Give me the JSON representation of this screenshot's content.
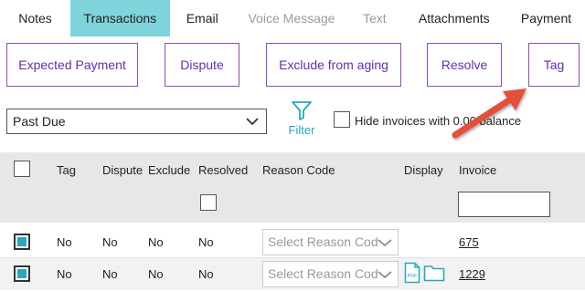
{
  "tabs": [
    {
      "label": "Notes",
      "state": "normal"
    },
    {
      "label": "Transactions",
      "state": "active"
    },
    {
      "label": "Email",
      "state": "normal"
    },
    {
      "label": "Voice Message",
      "state": "disabled"
    },
    {
      "label": "Text",
      "state": "disabled"
    },
    {
      "label": "Attachments",
      "state": "normal"
    },
    {
      "label": "Payment",
      "state": "normal"
    }
  ],
  "actions": {
    "expected_payment": "Expected Payment",
    "dispute": "Dispute",
    "exclude_from_aging": "Exclude from aging",
    "resolve": "Resolve",
    "tag": "Tag"
  },
  "filters": {
    "view_select_value": "Past Due",
    "filter_label": "Filter",
    "hide_zero_balance_label": "Hide invoices with 0.00 balance",
    "hide_zero_balance_checked": false
  },
  "grid": {
    "columns": {
      "tag": "Tag",
      "dispute": "Dispute",
      "exclude": "Exclude /",
      "resolved": "Resolved",
      "reason_code": "Reason Code",
      "display": "Display",
      "invoice": "Invoice"
    },
    "reason_placeholder": "Select Reason Code",
    "rows": [
      {
        "selected": true,
        "tag": "No",
        "dispute": "No",
        "exclude": "No",
        "resolved": "No",
        "reason_code": "Select Reason Code",
        "has_documents": false,
        "invoice": "675"
      },
      {
        "selected": true,
        "tag": "No",
        "dispute": "No",
        "exclude": "No",
        "resolved": "No",
        "reason_code": "Select Reason Code",
        "has_documents": true,
        "invoice": "1229"
      }
    ]
  },
  "icons": {
    "filter": "filter-funnel-icon",
    "select_chevron": "chevron-down-icon",
    "pdf": "pdf-file-icon",
    "folder": "folder-icon",
    "annotation": "annotation-arrow"
  },
  "colors": {
    "active_tab": "#7fd3da",
    "button_border": "#8b4fb8",
    "button_text": "#6a2da8",
    "accent": "#2aa7b8",
    "arrow": "#e2503a"
  }
}
